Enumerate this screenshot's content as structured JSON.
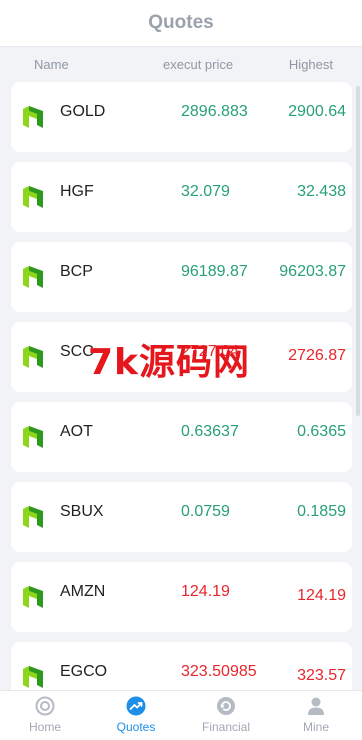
{
  "header": {
    "title": "Quotes"
  },
  "columns": {
    "name": "Name",
    "price": "execut price",
    "highest": "Highest"
  },
  "rows": [
    {
      "symbol": "GOLD",
      "price": "2896.883",
      "highest": "2900.64",
      "price_trend": "up",
      "highest_trend": "up"
    },
    {
      "symbol": "HGF",
      "price": "32.079",
      "highest": "32.438",
      "price_trend": "up",
      "highest_trend": "up"
    },
    {
      "symbol": "BCP",
      "price": "96189.87",
      "highest": "96203.87",
      "price_trend": "up",
      "highest_trend": "up"
    },
    {
      "symbol": "SCC",
      "price": "2727.04",
      "highest": "2726.87",
      "price_trend": "down",
      "highest_trend": "down"
    },
    {
      "symbol": "AOT",
      "price": "0.63637",
      "highest": "0.6365",
      "price_trend": "up",
      "highest_trend": "up"
    },
    {
      "symbol": "SBUX",
      "price": "0.0759",
      "highest": "0.1859",
      "price_trend": "up",
      "highest_trend": "up"
    },
    {
      "symbol": "AMZN",
      "price": "124.19",
      "highest": "124.19",
      "price_trend": "down",
      "highest_trend": "down"
    },
    {
      "symbol": "EGCO",
      "price": "323.50985",
      "highest": "323.57",
      "price_trend": "down",
      "highest_trend": "down"
    }
  ],
  "watermark": "7k源码网",
  "tabs": [
    {
      "label": "Home",
      "icon": "home-icon"
    },
    {
      "label": "Quotes",
      "icon": "quotes-icon",
      "active": true
    },
    {
      "label": "Financial",
      "icon": "financial-icon"
    },
    {
      "label": "Mine",
      "icon": "user-icon"
    }
  ],
  "colors": {
    "up": "#27a07a",
    "down": "#e8262d",
    "active_tab": "#1f8ee6",
    "logo_light": "#8ed61a",
    "logo_dark": "#2d9a1e"
  }
}
